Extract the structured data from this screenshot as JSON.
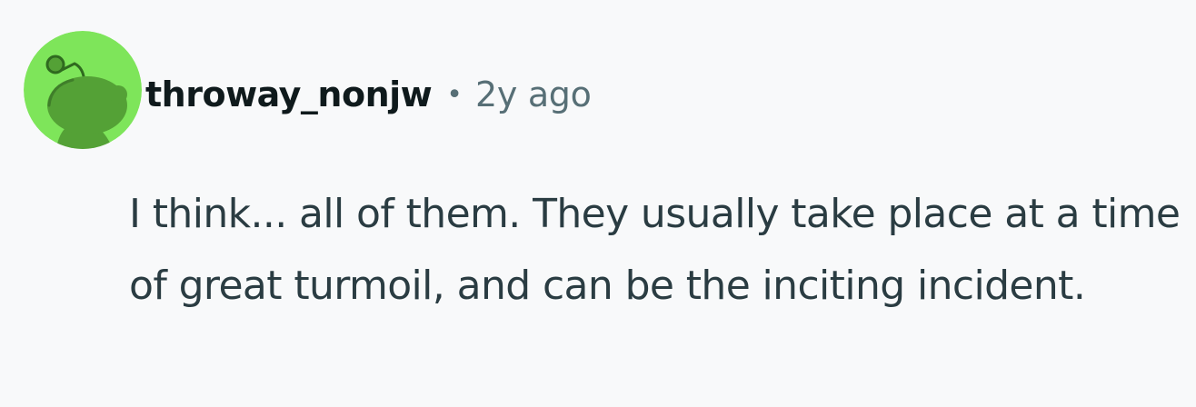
{
  "comment": {
    "username": "throway_nonjw",
    "separator": "•",
    "timestamp": "2y ago",
    "body": "I think... all of them. They usually take place at a time of great turmoil, and can be the inciting incident."
  },
  "avatar": {
    "icon": "snoo-avatar-icon",
    "background_color": "#7ee55a",
    "figure_color": "#54a136"
  },
  "colors": {
    "page_background": "#f8f9fa",
    "username": "#0f1a1c",
    "meta": "#576f76",
    "body_text": "#2a3c42"
  }
}
